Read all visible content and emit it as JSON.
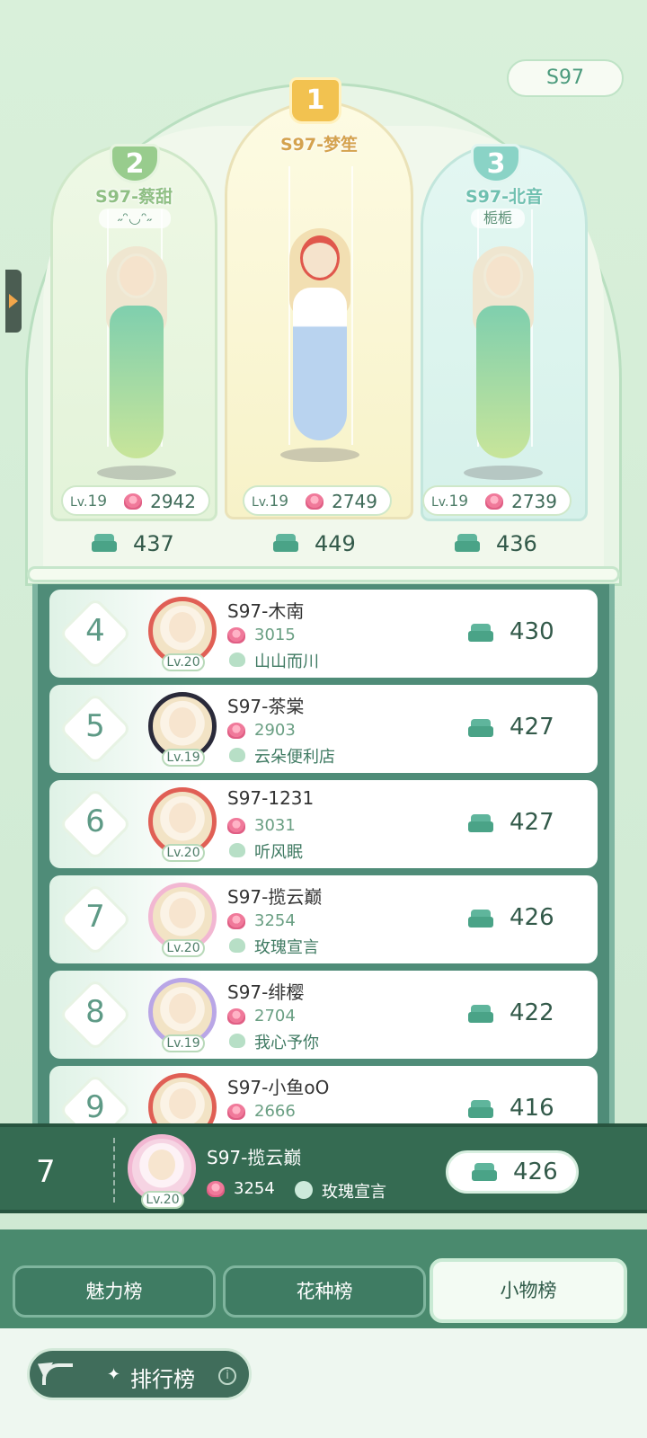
{
  "season_badge": "S97",
  "top3": [
    {
      "rank": "2",
      "name": "S97-蔡甜",
      "sub": "˶ᵔ◡ᵔ˶",
      "level_prefix": "Lv.",
      "level": "19",
      "score": "2942",
      "likes": "437"
    },
    {
      "rank": "1",
      "name": "S97-梦笙",
      "sub": "",
      "level_prefix": "Lv.",
      "level": "19",
      "score": "2749",
      "likes": "449"
    },
    {
      "rank": "3",
      "name": "S97-北音",
      "sub": "栀栀",
      "level_prefix": "Lv.",
      "level": "19",
      "score": "2739",
      "likes": "436"
    }
  ],
  "list": [
    {
      "rank": "4",
      "name": "S97-木南",
      "level": "Lv.20",
      "score": "3015",
      "shop": "山山而川",
      "likes": "430"
    },
    {
      "rank": "5",
      "name": "S97-茶棠",
      "level": "Lv.19",
      "score": "2903",
      "shop": "云朵便利店",
      "likes": "427"
    },
    {
      "rank": "6",
      "name": "S97-1231",
      "level": "Lv.20",
      "score": "3031",
      "shop": "听风眠",
      "likes": "427"
    },
    {
      "rank": "7",
      "name": "S97-揽云巅",
      "level": "Lv.20",
      "score": "3254",
      "shop": "玫瑰宣言",
      "likes": "426"
    },
    {
      "rank": "8",
      "name": "S97-绯樱",
      "level": "Lv.19",
      "score": "2704",
      "shop": "我心予你",
      "likes": "422"
    },
    {
      "rank": "9",
      "name": "S97-小鱼oO",
      "level": "",
      "score": "2666",
      "shop": "",
      "likes": "416"
    }
  ],
  "self": {
    "rank": "7",
    "name": "S97-揽云巅",
    "level": "Lv.20",
    "score": "3254",
    "shop": "玫瑰宣言",
    "likes": "426"
  },
  "tabs": [
    {
      "label": "魅力榜",
      "active": false
    },
    {
      "label": "花种榜",
      "active": false
    },
    {
      "label": "小物榜",
      "active": true
    }
  ],
  "footer": {
    "title": "排行榜",
    "info_symbol": "i"
  },
  "icons": {
    "rose": "rose-icon",
    "sofa": "sofa-icon",
    "shop": "leaf-shop-icon",
    "back": "back-arrow-icon",
    "crown": "crown-icon",
    "info": "info-icon"
  },
  "colors": {
    "accent_green": "#356b52",
    "rose": "#f0799a",
    "gold": "#f2c250"
  }
}
